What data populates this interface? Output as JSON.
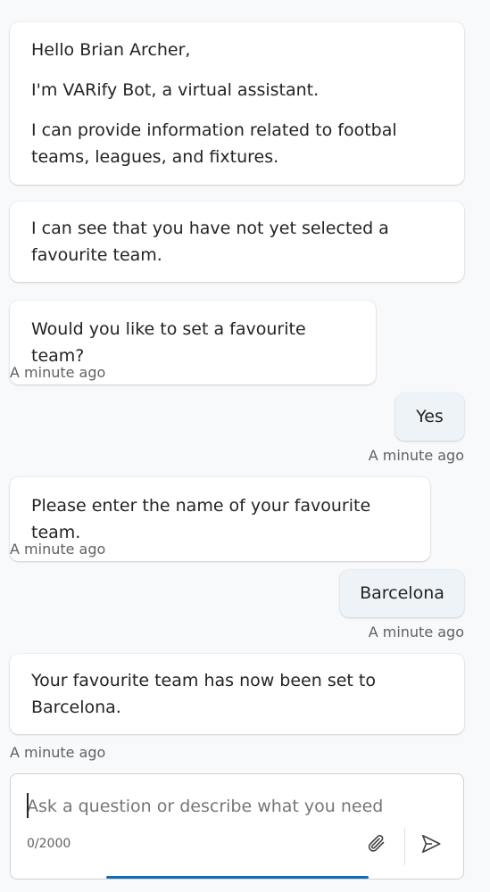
{
  "messages": [
    {
      "from": "bot",
      "lines": [
        "Hello Brian Archer,",
        "I'm VARify Bot, a virtual assistant.",
        "I can provide information related to footbal teams, leagues, and fixtures."
      ]
    },
    {
      "from": "bot",
      "lines": [
        "I can see that you have not yet selected a favourite team."
      ]
    },
    {
      "from": "bot",
      "lines": [
        "Would you like to set a favourite team?"
      ],
      "timestamp": "A minute ago"
    },
    {
      "from": "user",
      "text": "Yes",
      "timestamp": "A minute ago"
    },
    {
      "from": "bot",
      "lines": [
        "Please enter the name of your favourite team."
      ],
      "timestamp": "A minute ago"
    },
    {
      "from": "user",
      "text": "Barcelona",
      "timestamp": "A minute ago"
    },
    {
      "from": "bot",
      "lines": [
        "Your favourite team has now been set to Barcelona."
      ],
      "timestamp": "A minute ago"
    }
  ],
  "composer": {
    "placeholder": "Ask a question or describe what you need",
    "value": "",
    "counter": "0/2000",
    "attach_icon": "paperclip-icon",
    "send_icon": "send-icon"
  },
  "colors": {
    "background": "#f8f9fb",
    "bot_bubble": "#ffffff",
    "user_bubble": "#eef3f8",
    "accent": "#0f6cbd"
  }
}
